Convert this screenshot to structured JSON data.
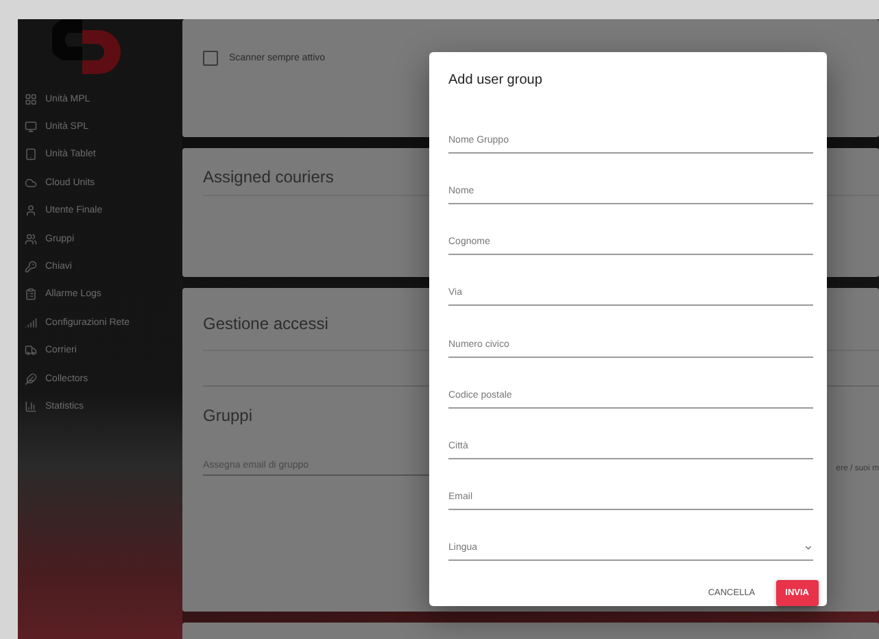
{
  "sidebar": {
    "items": [
      {
        "label": "Unità MPL"
      },
      {
        "label": "Unità SPL"
      },
      {
        "label": "Unità Tablet"
      },
      {
        "label": "Cloud Units"
      },
      {
        "label": "Utente Finale"
      },
      {
        "label": "Gruppi"
      },
      {
        "label": "Chiavi"
      },
      {
        "label": "Allarme Logs"
      },
      {
        "label": "Configurazioni Rete"
      },
      {
        "label": "Corrieri"
      },
      {
        "label": "Collectors"
      },
      {
        "label": "Statistics"
      }
    ]
  },
  "scanner": {
    "label": "Scanner sempre attivo",
    "checked": false
  },
  "couriers": {
    "title": "Assigned couriers"
  },
  "access": {
    "title": "Gestione accessi",
    "groups_title": "Gruppi",
    "group_email": {
      "placeholder": "Assegna email di gruppo"
    },
    "column_2_text": "ere / suoi m"
  },
  "dialog": {
    "title": "Add user group",
    "fields": [
      {
        "kind": "text",
        "placeholder": "Nome Gruppo"
      },
      {
        "kind": "text",
        "placeholder": "Nome"
      },
      {
        "kind": "text",
        "placeholder": "Cognome"
      },
      {
        "kind": "text",
        "placeholder": "Via"
      },
      {
        "kind": "text",
        "placeholder": "Numero civico"
      },
      {
        "kind": "text",
        "placeholder": "Codice postale"
      },
      {
        "kind": "text",
        "placeholder": "Città"
      },
      {
        "kind": "text",
        "placeholder": "Email"
      },
      {
        "kind": "select",
        "placeholder": "Lingua"
      }
    ],
    "buttons": [
      {
        "label": "CANCELLA",
        "kind": "text"
      },
      {
        "label": "INVIA",
        "kind": "primary"
      }
    ]
  }
}
